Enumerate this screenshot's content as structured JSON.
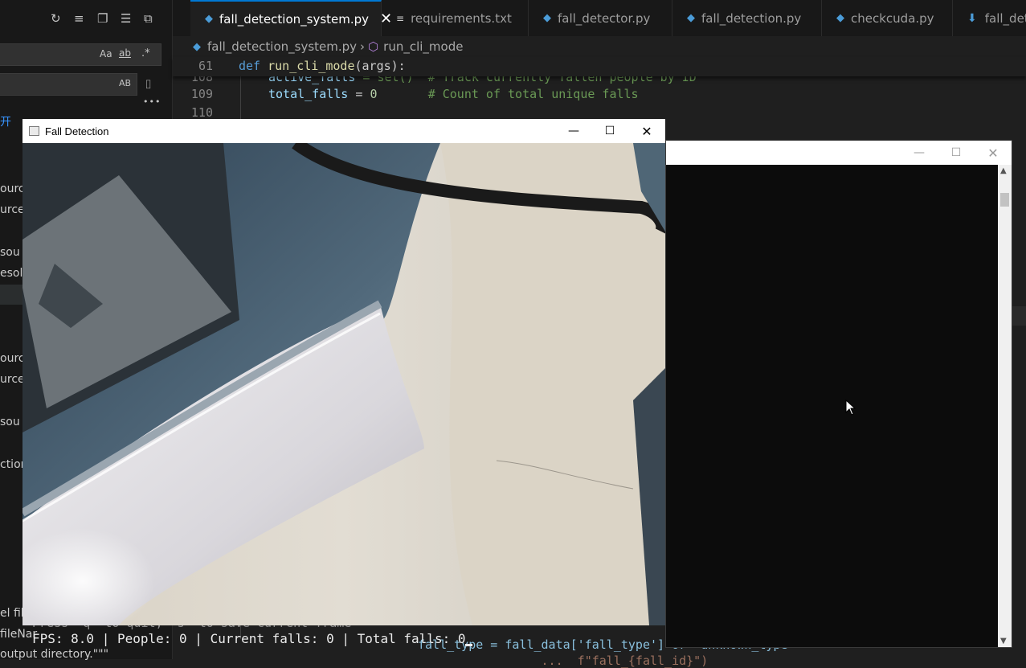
{
  "sidebar": {
    "toolbar_icons": [
      "refresh-icon",
      "clear-results-icon",
      "new-search-editor-icon",
      "collapse-all-icon",
      "view-as-tree-icon"
    ],
    "search_options": [
      "Aa",
      "ab",
      ".*"
    ],
    "replace_option": "AB",
    "more_label": "•••",
    "partial_lines": [
      {
        "text": "开",
        "color": "#3794ff"
      },
      {
        "text": "ourc",
        "color": "#cccccc"
      },
      {
        "text": "urce}",
        "color": "#cccccc"
      },
      {
        "text": "sou",
        "color": "#cccccc"
      },
      {
        "text": "esolu",
        "color": "#cccccc"
      },
      {
        "text": "ourc",
        "color": "#cccccc"
      },
      {
        "text": "urce}",
        "color": "#cccccc"
      },
      {
        "text": "sou",
        "color": "#cccccc"
      },
      {
        "text": "ction:",
        "color": "#cccccc"
      },
      {
        "text": "el fil",
        "color": "#cccccc"
      },
      {
        "text": "fileNar",
        "color": "#cccccc"
      },
      {
        "text": "output directory.\"\"\"",
        "color": "#cccccc"
      }
    ]
  },
  "tabs": [
    {
      "label": "fall_detection_system.py",
      "type": "py",
      "active": true
    },
    {
      "label": "requirements.txt",
      "type": "txt",
      "active": false
    },
    {
      "label": "fall_detector.py",
      "type": "py",
      "active": false
    },
    {
      "label": "fall_detection.py",
      "type": "py",
      "active": false
    },
    {
      "label": "checkcuda.py",
      "type": "py",
      "active": false
    },
    {
      "label": "fall_det",
      "type": "dl",
      "active": false
    }
  ],
  "breadcrumb": {
    "file": "fall_detection_system.py",
    "symbol": "run_cli_mode"
  },
  "code": {
    "sticky": {
      "line": "61",
      "kw": "def",
      "fn": "run_cli_mode",
      "rest": "(args):"
    },
    "line108": {
      "num": "108",
      "var": "active_falls",
      "rest": " = set()  # Track currently fallen people by ID"
    },
    "line109": {
      "num": "109",
      "var": "total_falls",
      "op": " = ",
      "val": "0",
      "cmt": "# Count of total unique falls"
    },
    "line110": {
      "num": "110"
    },
    "bottom1": "fall_type = fall_data['fall_type'] or 'unknown_type'",
    "bottom2": "                 ...  f\"fall_{fall_id}\")"
  },
  "terminal": {
    "hint": "Press 'q' to quit, 's' to save current frame",
    "fps": "FPS: 8.0",
    "people": "People: 0",
    "current": "Current falls: 0",
    "total": "Total falls: 0",
    "sep": " | "
  },
  "cv_window": {
    "title": "Fall Detection",
    "minimize": "—",
    "maximize": "☐",
    "close": "✕"
  },
  "console_window": {
    "minimize": "—",
    "maximize": "☐",
    "close": "✕"
  }
}
